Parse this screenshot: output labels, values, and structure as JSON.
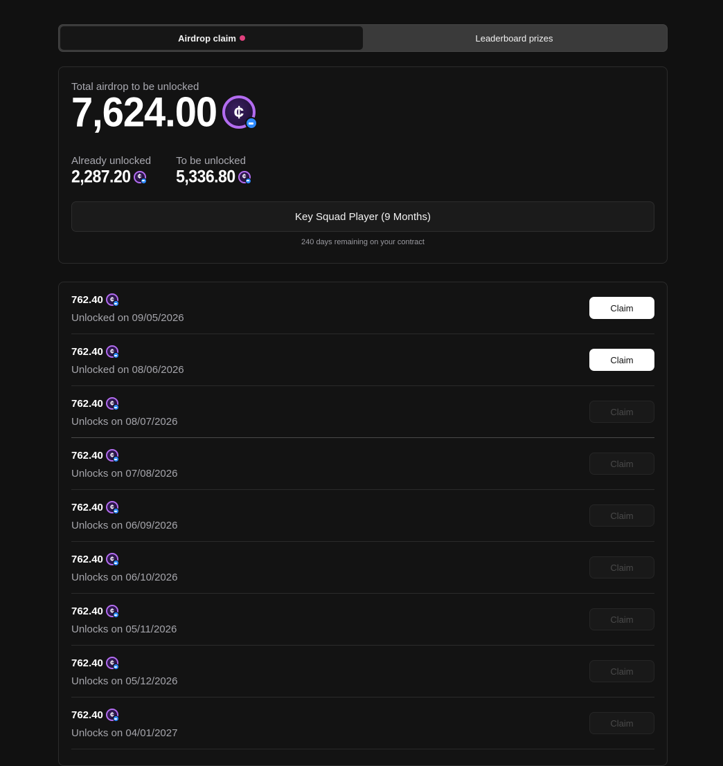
{
  "tabs": [
    {
      "label": "Airdrop claim",
      "active": true,
      "has_dot": true
    },
    {
      "label": "Leaderboard prizes",
      "active": false
    }
  ],
  "summary": {
    "total_label": "Total airdrop to be unlocked",
    "total_value": "7,624.00",
    "unlocked_label": "Already unlocked",
    "unlocked_value": "2,287.20",
    "pending_label": "To be unlocked",
    "pending_value": "5,336.80",
    "contract_button": "Key Squad Player (9 Months)",
    "contract_note": "240 days remaining on your contract"
  },
  "coin_icon": "coin-icon",
  "colors": {
    "accent": "#b36cf0",
    "badge": "#2f8bff",
    "dot": "#e0417e"
  },
  "unlocks": [
    {
      "amount": "762.40",
      "date": "Unlocked on 09/05/2026",
      "claim": "Claim",
      "enabled": true
    },
    {
      "amount": "762.40",
      "date": "Unlocked on 08/06/2026",
      "claim": "Claim",
      "enabled": true
    },
    {
      "amount": "762.40",
      "date": "Unlocks on 08/07/2026",
      "claim": "Claim",
      "enabled": false
    },
    {
      "amount": "762.40",
      "date": "Unlocks on 07/08/2026",
      "claim": "Claim",
      "enabled": false
    },
    {
      "amount": "762.40",
      "date": "Unlocks on 06/09/2026",
      "claim": "Claim",
      "enabled": false
    },
    {
      "amount": "762.40",
      "date": "Unlocks on 06/10/2026",
      "claim": "Claim",
      "enabled": false
    },
    {
      "amount": "762.40",
      "date": "Unlocks on 05/11/2026",
      "claim": "Claim",
      "enabled": false
    },
    {
      "amount": "762.40",
      "date": "Unlocks on 05/12/2026",
      "claim": "Claim",
      "enabled": false
    },
    {
      "amount": "762.40",
      "date": "Unlocks on 04/01/2027",
      "claim": "Claim",
      "enabled": false
    }
  ]
}
